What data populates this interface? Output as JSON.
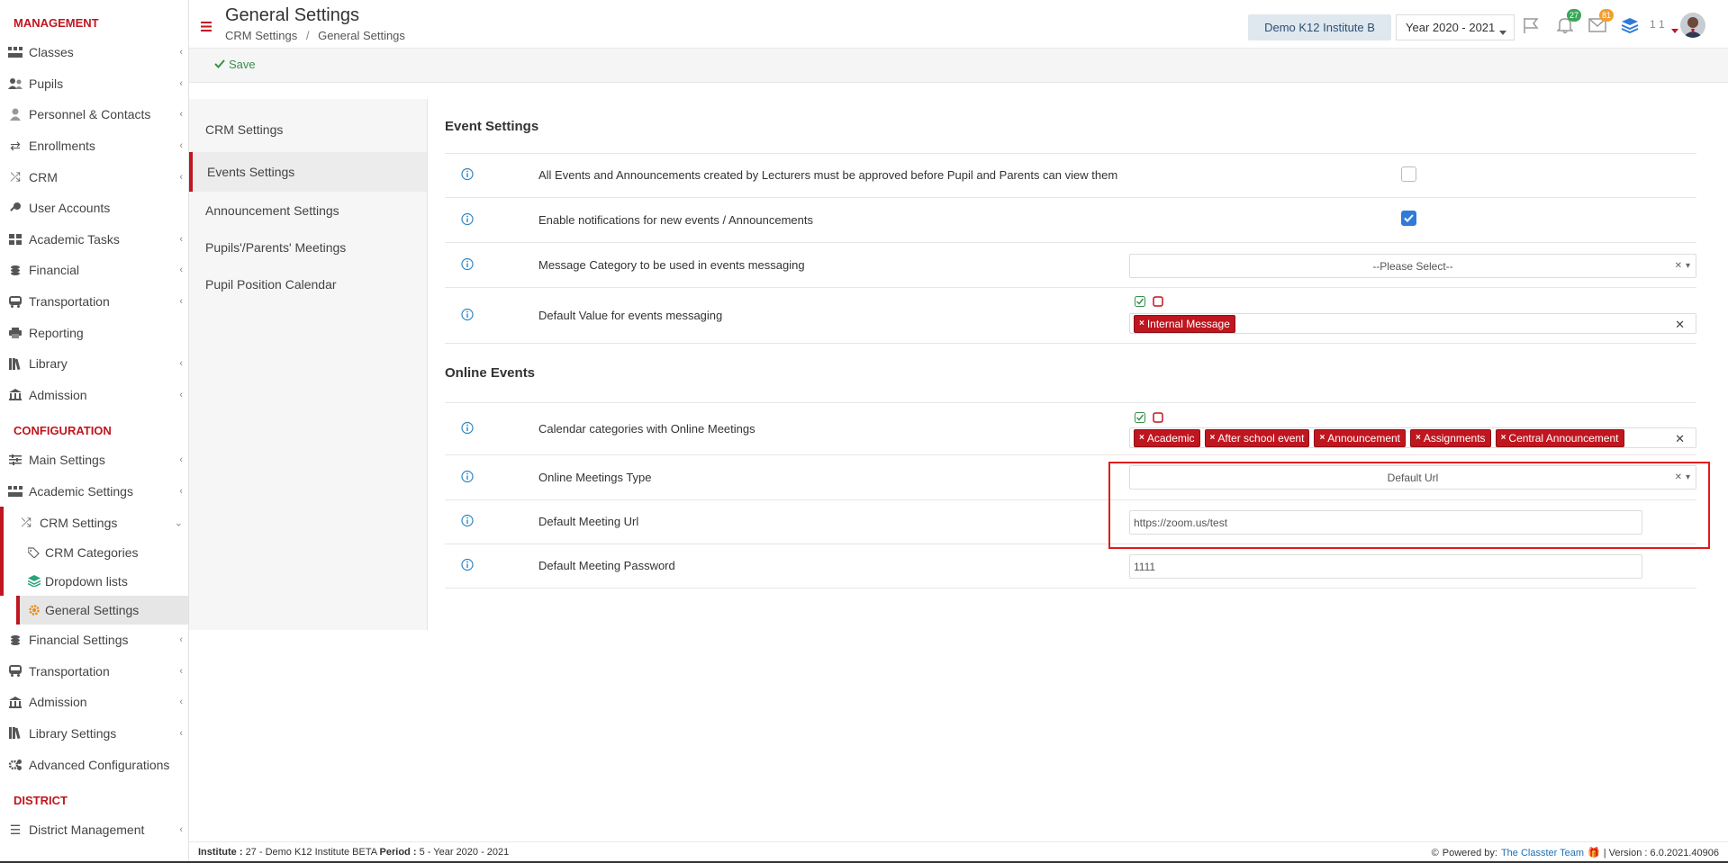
{
  "sidebar": {
    "management_label": "MANAGEMENT",
    "management": [
      {
        "label": "Classes",
        "icon": "classes-icon"
      },
      {
        "label": "Pupils",
        "icon": "pupils-icon"
      },
      {
        "label": "Personnel & Contacts",
        "icon": "person-icon"
      },
      {
        "label": "Enrollments",
        "icon": "exchange-icon"
      },
      {
        "label": "CRM",
        "icon": "shuffle-icon"
      },
      {
        "label": "User Accounts",
        "icon": "key-icon"
      },
      {
        "label": "Academic Tasks",
        "icon": "grid-icon"
      },
      {
        "label": "Financial",
        "icon": "coins-icon"
      },
      {
        "label": "Transportation",
        "icon": "bus-icon"
      },
      {
        "label": "Reporting",
        "icon": "print-icon"
      },
      {
        "label": "Library",
        "icon": "books-icon"
      },
      {
        "label": "Admission",
        "icon": "bank-icon"
      }
    ],
    "configuration_label": "CONFIGURATION",
    "configuration": {
      "main_settings": "Main Settings",
      "academic_settings": "Academic Settings",
      "crm_settings": "CRM Settings",
      "crm_categories": "CRM Categories",
      "dropdown_lists": "Dropdown lists",
      "general_settings": "General Settings",
      "financial_settings": "Financial Settings",
      "transportation": "Transportation",
      "admission": "Admission",
      "library_settings": "Library Settings",
      "advanced_configurations": "Advanced Configurations"
    },
    "district_label": "DISTRICT",
    "district_management": "District Management"
  },
  "header": {
    "title": "General Settings",
    "breadcrumb_1": "CRM Settings",
    "breadcrumb_sep": "/",
    "breadcrumb_2": "General Settings",
    "institute": "Demo K12 Institute B",
    "year": "Year 2020 - 2021",
    "notifications_count": "27",
    "messages_count": "81",
    "user_text": "1 1",
    "colors": {
      "accent": "#c0161f",
      "notif_badge": "#3aa757",
      "msg_badge": "#f0a030"
    }
  },
  "toolbar": {
    "save_label": "Save"
  },
  "settings_nav": {
    "items": [
      "CRM Settings",
      "Events Settings",
      "Announcement Settings",
      "Pupils'/Parents' Meetings",
      "Pupil Position Calendar"
    ],
    "active": "Events Settings"
  },
  "event_settings": {
    "title": "Event Settings",
    "approve_label": "All Events and Announcements created by Lecturers must be approved before Pupil and Parents can view them",
    "approve_checked": false,
    "notify_label": "Enable notifications for new events / Announcements",
    "notify_checked": true,
    "message_category_label": "Message Category to be used in events messaging",
    "message_category_value": "--Please Select--",
    "default_value_label": "Default Value for events messaging",
    "default_value_tags": [
      "Internal Message"
    ]
  },
  "online_events": {
    "title": "Online Events",
    "calendar_label": "Calendar categories with Online Meetings",
    "calendar_tags": [
      "Academic",
      "After school event",
      "Announcement",
      "Assignments",
      "Central Announcement"
    ],
    "meetings_type_label": "Online Meetings Type",
    "meetings_type_value": "Default Url",
    "meeting_url_label": "Default Meeting Url",
    "meeting_url_value": "https://zoom.us/test",
    "meeting_password_label": "Default Meeting Password",
    "meeting_password_value": "1111"
  },
  "footer": {
    "institute_label": "Institute :",
    "institute_value": "27 - Demo K12 Institute BETA",
    "period_label": "Period :",
    "period_value": "5 - Year 2020 - 2021",
    "powered_by": "Powered by:",
    "team": "The Classter Team",
    "version": "| Version : 6.0.2021.40906"
  }
}
